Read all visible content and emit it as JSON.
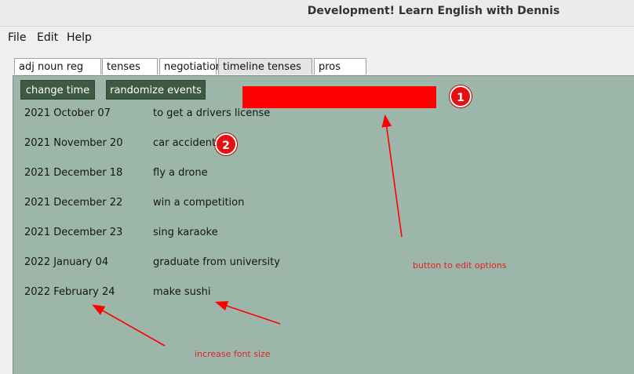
{
  "window": {
    "title": "Development! Learn English with Dennis"
  },
  "menu": [
    {
      "label": "File"
    },
    {
      "label": "Edit"
    },
    {
      "label": "Help"
    }
  ],
  "tabs": [
    {
      "label": "adj noun reg verb"
    },
    {
      "label": "tenses tab"
    },
    {
      "label": "negotiation"
    },
    {
      "label": "timeline tenses tab",
      "active": true
    },
    {
      "label": "pros cons"
    }
  ],
  "buttons": {
    "change_time": "change time",
    "randomize_events": "randomize events"
  },
  "timeline": [
    {
      "date": "2021 October 07",
      "event": "to get a drivers license"
    },
    {
      "date": "2021 November 20",
      "event": "car accident"
    },
    {
      "date": "2021 December 18",
      "event": "fly a drone"
    },
    {
      "date": "2021 December 22",
      "event": "win a competition"
    },
    {
      "date": "2021 December 23",
      "event": "sing karaoke"
    },
    {
      "date": "2022 January 04",
      "event": "graduate from university"
    },
    {
      "date": "2022 February 24",
      "event": "make sushi"
    }
  ],
  "annotations": {
    "badge1": "1",
    "badge2": "2",
    "note_edit": "button to edit options",
    "note_font": "increase font size",
    "color": "#ff0000"
  }
}
